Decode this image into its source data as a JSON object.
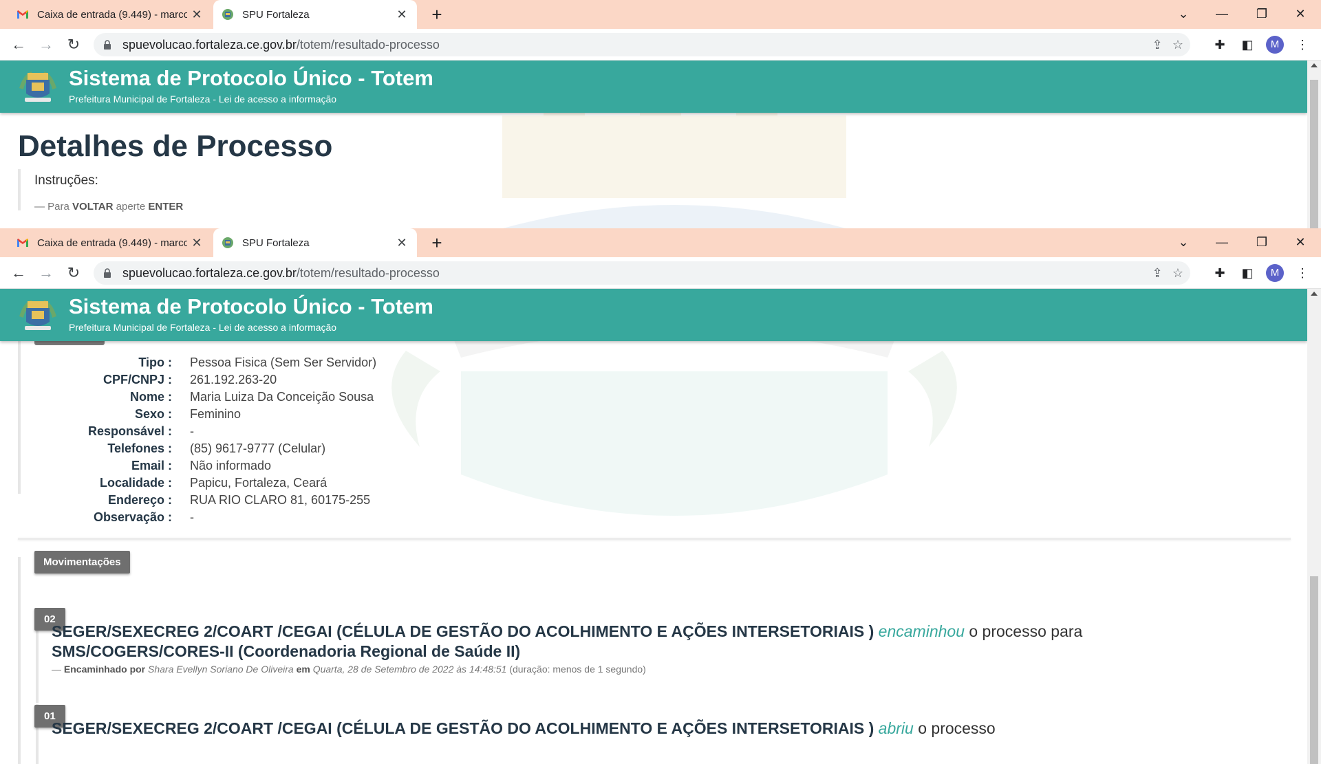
{
  "browser": {
    "tabs": [
      {
        "title": "Caixa de entrada (9.449) - marco",
        "icon": "gmail-icon",
        "active": false
      },
      {
        "title": "SPU Fortaleza",
        "icon": "city-crest-icon",
        "active": true
      }
    ],
    "url_host": "spuevolucao.fortaleza.ce.gov.br",
    "url_path": "/totem/resultado-processo",
    "profile_initial": "M"
  },
  "app": {
    "title": "Sistema de Protocolo Único - Totem",
    "subtitle": "Prefeitura Municipal de Fortaleza - Lei de acesso a informação",
    "header_color": "#38a89d"
  },
  "page": {
    "heading": "Detalhes de Processo",
    "instructions_title": "Instruções:",
    "instructions_dash": "— Para",
    "instructions_key1": "VOLTAR",
    "instructions_mid": "aperte",
    "instructions_key2": "ENTER"
  },
  "interessado": {
    "fields": [
      {
        "label": "Tipo :",
        "value": "Pessoa Fisica (Sem Ser Servidor)"
      },
      {
        "label": "CPF/CNPJ :",
        "value": "261.192.263-20"
      },
      {
        "label": "Nome :",
        "value": "Maria Luiza Da Conceição Sousa"
      },
      {
        "label": "Sexo :",
        "value": "Feminino"
      },
      {
        "label": "Responsável :",
        "value": "-"
      },
      {
        "label": "Telefones :",
        "value": "(85) 9617-9777 (Celular)"
      },
      {
        "label": "Email :",
        "value": "Não informado"
      },
      {
        "label": "Localidade :",
        "value": "Papicu, Fortaleza, Ceará"
      },
      {
        "label": "Endereço :",
        "value": "RUA RIO CLARO 81, 60175-255"
      },
      {
        "label": "Observação :",
        "value": "-"
      }
    ]
  },
  "movimentacoes": {
    "label": "Movimentações",
    "items": [
      {
        "number": "02",
        "origin": "SEGER/SEXECREG 2/COART /CEGAI (CÉLULA DE GESTÃO DO ACOLHIMENTO E AÇÕES INTERSETORIAIS )",
        "action": "encaminhou",
        "connector": "o processo para",
        "destination": "SMS/COGERS/CORES-II (Coordenadoria Regional de Saúde II)",
        "meta_dash": "—",
        "meta_label": "Encaminhado por",
        "meta_user": "Shara Evellyn Soriano De Oliveira",
        "meta_em": "em",
        "meta_date": "Quarta, 28 de Setembro de 2022 às 14:48:51",
        "meta_duration": "(duração: menos de 1 segundo)"
      },
      {
        "number": "01",
        "origin": "SEGER/SEXECREG 2/COART /CEGAI (CÉLULA DE GESTÃO DO ACOLHIMENTO E AÇÕES INTERSETORIAIS )",
        "action": "abriu",
        "connector": "o processo"
      }
    ]
  }
}
